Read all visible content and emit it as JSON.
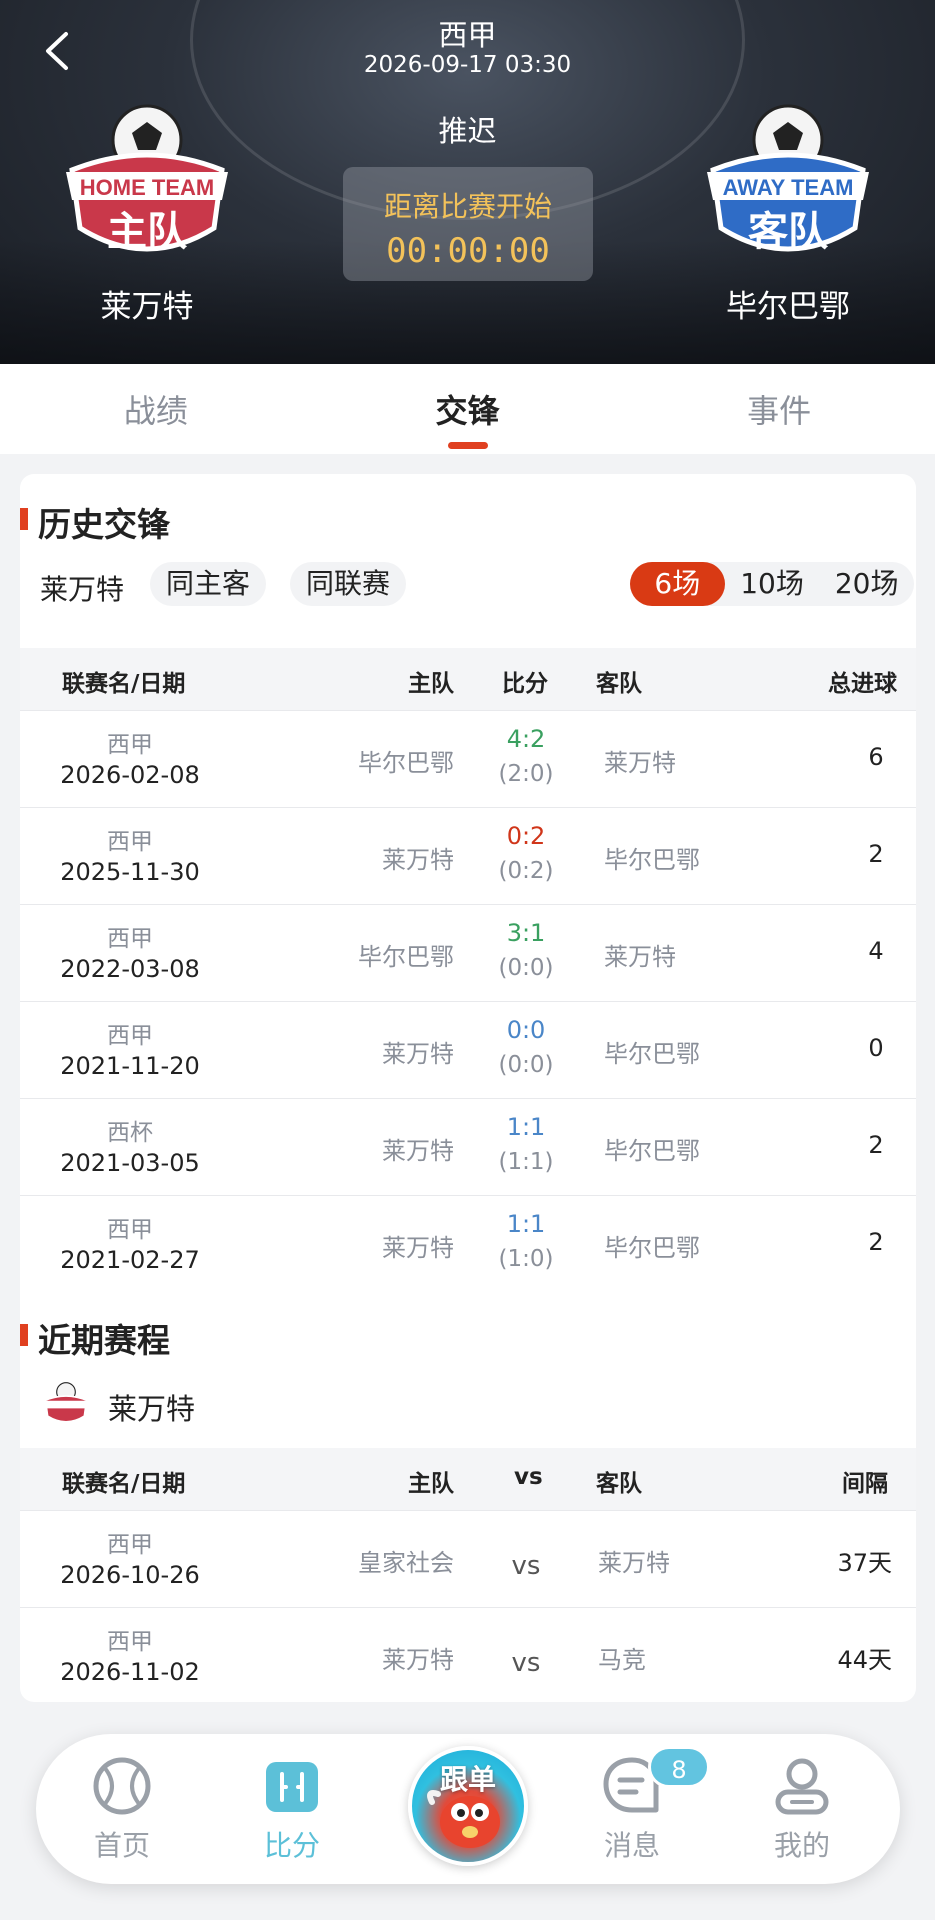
{
  "header": {
    "league": "西甲",
    "datetime": "2026-09-17 03:30",
    "status": "推迟",
    "countdown_label": "距离比赛开始",
    "countdown_time": "00:00:00",
    "home_team": "莱万特",
    "away_team": "毕尔巴鄂",
    "home_badge_text": "HOME TEAM",
    "home_badge_cn": "主队",
    "away_badge_text": "AWAY TEAM",
    "away_badge_cn": "客队"
  },
  "tabs": [
    {
      "label": "战绩"
    },
    {
      "label": "交锋"
    },
    {
      "label": "事件"
    }
  ],
  "history": {
    "title": "历史交锋",
    "team_filter": "莱万特",
    "chips": [
      "同主客",
      "同联赛"
    ],
    "segments": [
      "6场",
      "10场",
      "20场"
    ],
    "columns": {
      "league_date": "联赛名/日期",
      "home": "主队",
      "score": "比分",
      "away": "客队",
      "total": "总进球"
    },
    "rows": [
      {
        "league": "西甲",
        "date": "2026-02-08",
        "home": "毕尔巴鄂",
        "score": "4:2",
        "half": "(2:0)",
        "away": "莱万特",
        "total": "6",
        "result_color": "#3aa060"
      },
      {
        "league": "西甲",
        "date": "2025-11-30",
        "home": "莱万特",
        "score": "0:2",
        "half": "(0:2)",
        "away": "毕尔巴鄂",
        "total": "2",
        "result_color": "#d0361a"
      },
      {
        "league": "西甲",
        "date": "2022-03-08",
        "home": "毕尔巴鄂",
        "score": "3:1",
        "half": "(0:0)",
        "away": "莱万特",
        "total": "4",
        "result_color": "#3aa060"
      },
      {
        "league": "西甲",
        "date": "2021-11-20",
        "home": "莱万特",
        "score": "0:0",
        "half": "(0:0)",
        "away": "毕尔巴鄂",
        "total": "0",
        "result_color": "#4a86c8"
      },
      {
        "league": "西杯",
        "date": "2021-03-05",
        "home": "莱万特",
        "score": "1:1",
        "half": "(1:1)",
        "away": "毕尔巴鄂",
        "total": "2",
        "result_color": "#4a86c8"
      },
      {
        "league": "西甲",
        "date": "2021-02-27",
        "home": "莱万特",
        "score": "1:1",
        "half": "(1:0)",
        "away": "毕尔巴鄂",
        "total": "2",
        "result_color": "#4a86c8"
      }
    ]
  },
  "recent": {
    "title": "近期赛程",
    "team": "莱万特",
    "columns": {
      "league_date": "联赛名/日期",
      "home": "主队",
      "vs": "vs",
      "away": "客队",
      "gap": "间隔"
    },
    "rows": [
      {
        "league": "西甲",
        "date": "2026-10-26",
        "home": "皇家社会",
        "vs": "vs",
        "away": "莱万特",
        "gap": "37天"
      },
      {
        "league": "西甲",
        "date": "2026-11-02",
        "home": "莱万特",
        "vs": "vs",
        "away": "马竞",
        "gap": "44天"
      }
    ]
  },
  "nav": {
    "items": [
      {
        "label": "首页",
        "icon": "tennis-ball-icon"
      },
      {
        "label": "比分",
        "icon": "score-icon"
      },
      {
        "label": "跟单",
        "icon": "mascot-icon"
      },
      {
        "label": "消息",
        "icon": "message-icon"
      },
      {
        "label": "我的",
        "icon": "user-icon"
      }
    ],
    "message_badge": "8"
  },
  "colors": {
    "accent": "#e04020",
    "active_nav": "#5cc0d8",
    "countdown": "#f3c25a"
  }
}
